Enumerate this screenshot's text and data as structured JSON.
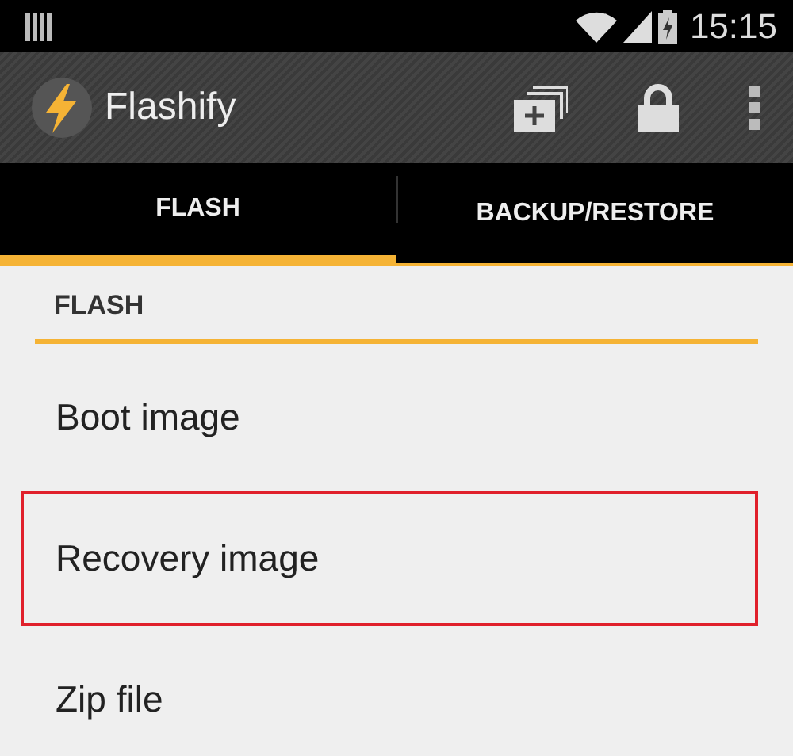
{
  "status_bar": {
    "time": "15:15"
  },
  "action_bar": {
    "title": "Flashify"
  },
  "tabs": [
    {
      "label": "FLASH",
      "selected": true
    },
    {
      "label": "BACKUP/RESTORE",
      "selected": false
    }
  ],
  "section": {
    "title": "FLASH"
  },
  "items": [
    {
      "label": "Boot image",
      "highlighted": false
    },
    {
      "label": "Recovery image",
      "highlighted": true
    },
    {
      "label": "Zip file",
      "highlighted": false
    }
  ]
}
